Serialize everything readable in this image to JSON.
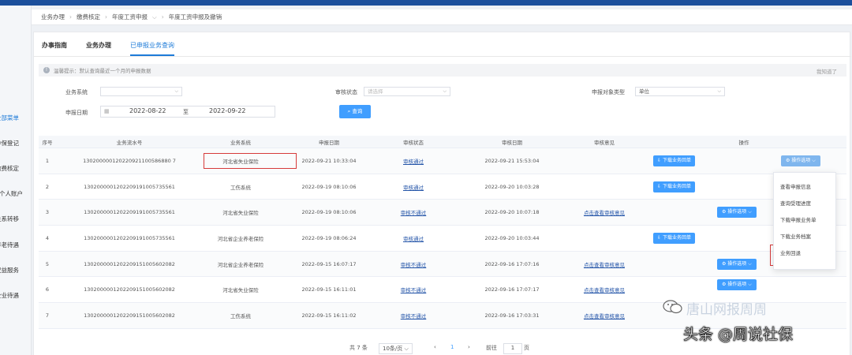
{
  "breadcrumb": [
    "业务办理",
    "缴费核定",
    "年度工资申报",
    "年度工资申报及撤销"
  ],
  "sidebar": [
    {
      "label": "全部菜单",
      "active": true
    },
    {
      "label": "参保登记",
      "active": false
    },
    {
      "label": "缴费核定",
      "active": false
    },
    {
      "label": "个人账户",
      "active": false
    },
    {
      "label": "关系转移",
      "active": false
    },
    {
      "label": "养老待遇",
      "active": false
    },
    {
      "label": "权益服务",
      "active": false
    },
    {
      "label": "企业待遇",
      "active": false
    }
  ],
  "tabs": [
    {
      "label": "办事指南",
      "active": false
    },
    {
      "label": "业务办理",
      "active": false
    },
    {
      "label": "已申报业务查询",
      "active": true
    }
  ],
  "notice": {
    "text": "温馨提示：默认查询最近一个月的申报数据",
    "close": "我知道了"
  },
  "filters": {
    "system_label": "业务系统",
    "system_value": "",
    "status_label": "审核状态",
    "status_placeholder": "请选择",
    "object_label": "申报对象类型",
    "object_value": "单位",
    "date_label": "申报日期",
    "date_from": "2022-08-22",
    "date_to_sep": "至",
    "date_to": "2022-09-22",
    "query_button": "查询"
  },
  "table": {
    "headers": [
      "序号",
      "业务流水号",
      "业务系统",
      "申报日期",
      "审核状态",
      "审核日期",
      "审核意见",
      "操作"
    ],
    "rows": [
      {
        "no": "1",
        "serial": "130200000120220921100586880 7",
        "system": "河北省失业保险",
        "date": "2022-09-21 10:33:04",
        "status": "审核通过",
        "status_type": "pass",
        "audit_date": "2022-09-21 15:53:04",
        "opinion": "",
        "download": "下载业务回单",
        "op": "操作选项"
      },
      {
        "no": "2",
        "serial": "1302000001202209191005735561",
        "system": "工伤系统",
        "date": "2022-09-19 08:10:06",
        "status": "审核通过",
        "status_type": "pass",
        "audit_date": "2022-09-20 10:03:28",
        "opinion": "",
        "download": "下载业务回单",
        "op": ""
      },
      {
        "no": "3",
        "serial": "1302000001202209191005735561",
        "system": "河北省失业保险",
        "date": "2022-09-19 08:10:06",
        "status": "审核不通过",
        "status_type": "fail",
        "audit_date": "2022-09-20 10:07:18",
        "opinion": "点击查看审核意见",
        "download": "",
        "op": "操作选项"
      },
      {
        "no": "4",
        "serial": "1302000001202209191005735561",
        "system": "河北省企业养老保险",
        "date": "2022-09-19 08:06:24",
        "status": "审核通过",
        "status_type": "pass",
        "audit_date": "2022-09-20 10:03:44",
        "opinion": "",
        "download": "下载业务回单",
        "op": ""
      },
      {
        "no": "5",
        "serial": "1302000001202209151005602082",
        "system": "河北省企业养老保险",
        "date": "2022-09-15 16:07:17",
        "status": "审核不通过",
        "status_type": "fail",
        "audit_date": "2022-09-16 17:07:16",
        "opinion": "点击查看审核意见",
        "download": "",
        "op": "操作选项"
      },
      {
        "no": "6",
        "serial": "1302000001202209151005602082",
        "system": "河北省失业保险",
        "date": "2022-09-15 16:11:01",
        "status": "审核不通过",
        "status_type": "fail",
        "audit_date": "2022-09-16 17:07:17",
        "opinion": "点击查看审核意见",
        "download": "",
        "op": "操作选项"
      },
      {
        "no": "7",
        "serial": "1302000001202209151005602082",
        "system": "工伤系统",
        "date": "2022-09-15 16:11:02",
        "status": "审核不通过",
        "status_type": "fail",
        "audit_date": "2022-09-16 17:03:31",
        "opinion": "点击查看审核意见",
        "download": "",
        "op": ""
      }
    ]
  },
  "dropdown": [
    "查看申报信息",
    "查询受理进度",
    "下载申报业务单",
    "下载业务档案",
    "业务回退"
  ],
  "pager": {
    "total": "共 7 条",
    "page_size": "10条/页",
    "prev": "‹",
    "current": "1",
    "next": "›",
    "goto": "前往",
    "goto_value": "1",
    "page_unit": "页"
  },
  "watermarks": {
    "a": "唐山网报周周",
    "b": "头条 @周说社保"
  },
  "colors": {
    "primary": "#409eff",
    "topbar": "#1b4f9c",
    "highlight": "#d63a3a",
    "link": "#2354a8"
  }
}
